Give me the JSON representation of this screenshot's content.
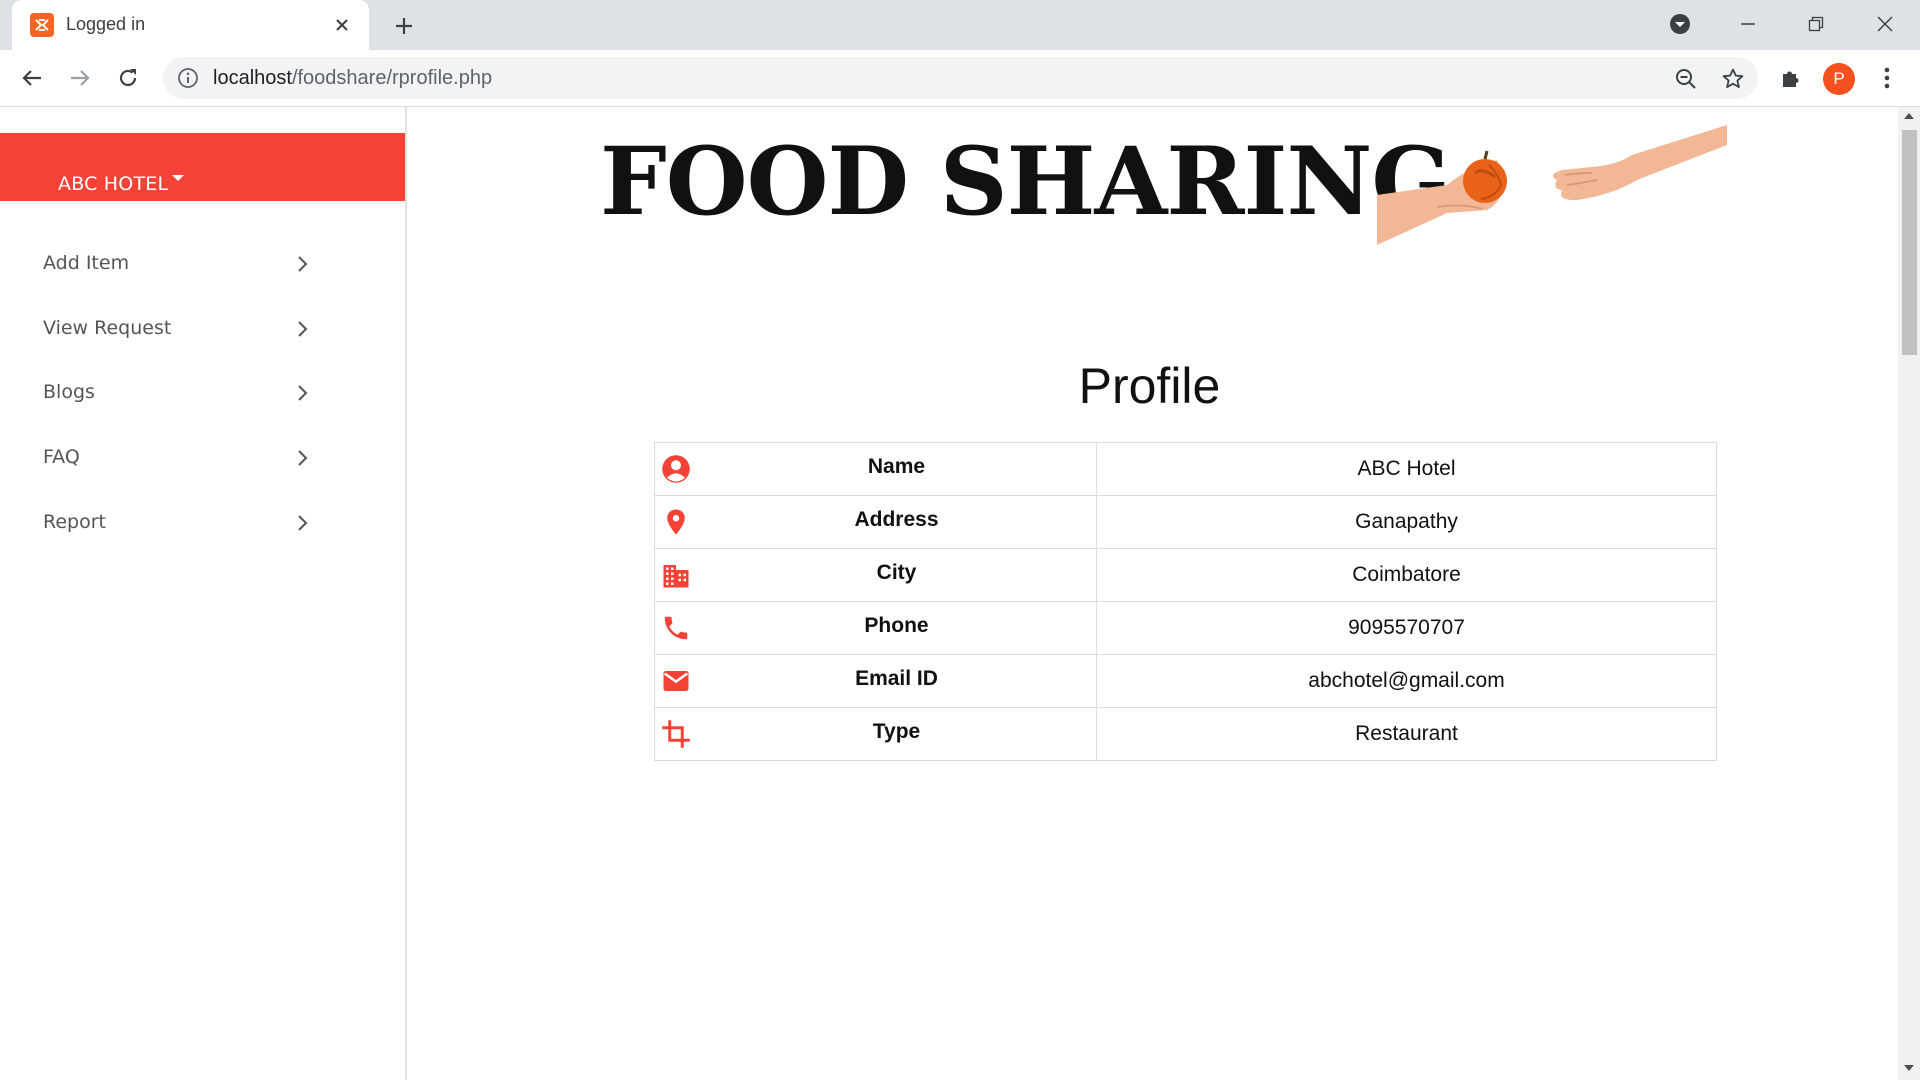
{
  "browser": {
    "tab_title": "Logged in",
    "url_host": "localhost",
    "url_path": "/foodshare/rprofile.php",
    "profile_initial": "P"
  },
  "sidebar": {
    "brand": "ABC HOTEL",
    "items": [
      {
        "label": "Add Item"
      },
      {
        "label": "View Request"
      },
      {
        "label": "Blogs"
      },
      {
        "label": "FAQ"
      },
      {
        "label": "Report"
      }
    ]
  },
  "header": {
    "title": "FOOD SHARING"
  },
  "profile": {
    "heading": "Profile",
    "rows": [
      {
        "icon": "account-circle-icon",
        "field": "Name",
        "value": "ABC Hotel"
      },
      {
        "icon": "location-pin-icon",
        "field": "Address",
        "value": "Ganapathy"
      },
      {
        "icon": "city-building-icon",
        "field": "City",
        "value": "Coimbatore"
      },
      {
        "icon": "phone-icon",
        "field": "Phone",
        "value": "9095570707"
      },
      {
        "icon": "email-icon",
        "field": "Email ID",
        "value": "abchotel@gmail.com"
      },
      {
        "icon": "crop-icon",
        "field": "Type",
        "value": "Restaurant"
      }
    ]
  },
  "colors": {
    "accent": "#f44336",
    "favicon": "#f26522",
    "avatar": "#f4511e"
  }
}
